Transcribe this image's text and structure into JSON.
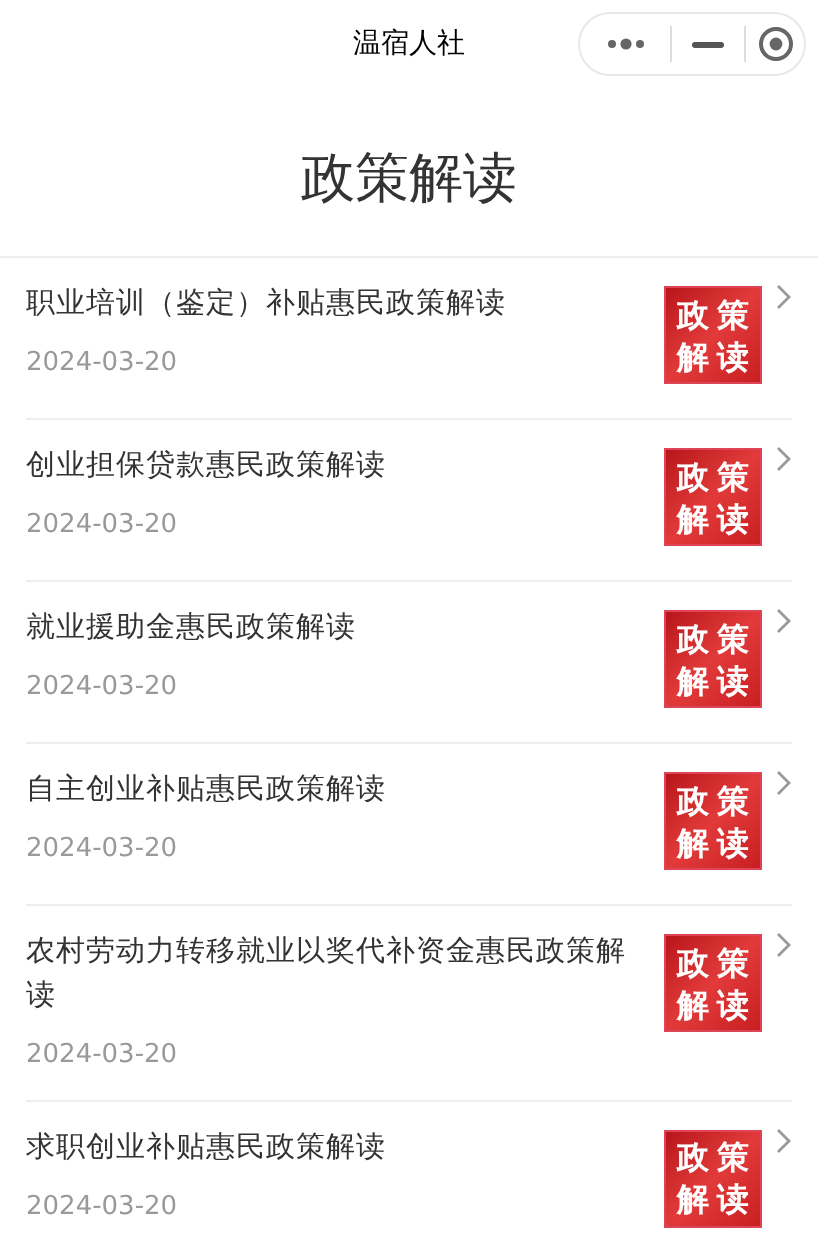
{
  "nav_bar": {
    "title": "温宿人社"
  },
  "page_title": "政策解读",
  "articles": [
    {
      "title": "职业培训（鉴定）补贴惠民政策解读",
      "date": "2024-03-20",
      "thumbnail": "政策解读"
    },
    {
      "title": "创业担保贷款惠民政策解读",
      "date": "2024-03-20",
      "thumbnail": "政策解读"
    },
    {
      "title": "就业援助金惠民政策解读",
      "date": "2024-03-20",
      "thumbnail": "政策解读"
    },
    {
      "title": "自主创业补贴惠民政策解读",
      "date": "2024-03-20",
      "thumbnail": "政策解读"
    },
    {
      "title": "农村劳动力转移就业以奖代补资金惠民政策解读",
      "date": "2024-03-20",
      "thumbnail": "政策解读"
    },
    {
      "title": "求职创业补贴惠民政策解读",
      "date": "2024-03-20",
      "thumbnail": "政策解读"
    }
  ]
}
